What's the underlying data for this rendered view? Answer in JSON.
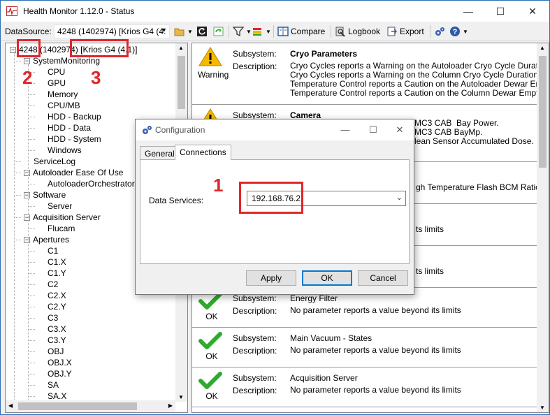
{
  "window": {
    "title": "Health Monitor 1.12.0 - Status",
    "minimize_icon": "—",
    "maximize_icon": "☐",
    "close_icon": "✕"
  },
  "toolbar": {
    "datasource_label": "DataSource:",
    "datasource_value": "4248 (1402974) [Krios G4 (4.",
    "compare_label": "Compare",
    "logbook_label": "Logbook",
    "export_label": "Export"
  },
  "tree": {
    "root_id": "4248",
    "root_serial": "(1402974)",
    "root_name": "[Krios G4 (4.1)]",
    "items": [
      {
        "label": "SystemMonitoring",
        "level": 1,
        "expander": "−"
      },
      {
        "label": "CPU",
        "level": 2
      },
      {
        "label": "GPU",
        "level": 2
      },
      {
        "label": "Memory",
        "level": 2
      },
      {
        "label": "CPU/MB",
        "level": 2
      },
      {
        "label": "HDD - Backup",
        "level": 2
      },
      {
        "label": "HDD - Data",
        "level": 2
      },
      {
        "label": "HDD - System",
        "level": 2
      },
      {
        "label": "Windows",
        "level": 2
      },
      {
        "label": "ServiceLog",
        "level": 1
      },
      {
        "label": "Autoloader Ease Of Use",
        "level": 1,
        "expander": "−"
      },
      {
        "label": "AutoloaderOrchestrator",
        "level": 2
      },
      {
        "label": "Software",
        "level": 1,
        "expander": "−"
      },
      {
        "label": "Server",
        "level": 2
      },
      {
        "label": "Acquisition Server",
        "level": 1,
        "expander": "−"
      },
      {
        "label": "Flucam",
        "level": 2
      },
      {
        "label": "Apertures",
        "level": 1,
        "expander": "−"
      },
      {
        "label": "C1",
        "level": 2
      },
      {
        "label": "C1.X",
        "level": 2
      },
      {
        "label": "C1.Y",
        "level": 2
      },
      {
        "label": "C2",
        "level": 2
      },
      {
        "label": "C2.X",
        "level": 2
      },
      {
        "label": "C2.Y",
        "level": 2
      },
      {
        "label": "C3",
        "level": 2
      },
      {
        "label": "C3.X",
        "level": 2
      },
      {
        "label": "C3.Y",
        "level": 2
      },
      {
        "label": "OBJ",
        "level": 2
      },
      {
        "label": "OBJ.X",
        "level": 2
      },
      {
        "label": "OBJ.Y",
        "level": 2
      },
      {
        "label": "SA",
        "level": 2
      },
      {
        "label": "SA.X",
        "level": 2
      }
    ]
  },
  "status_cards": [
    {
      "status": "Warning",
      "icon": "warning-icon",
      "subsystem_key": "Subsystem:",
      "subsystem": "Cryo Parameters",
      "desc_key": "Description:",
      "description": "Cryo Cycles reports a Warning on the Autoloader Cryo Cycle Duration.\nCryo Cycles reports a Warning on the Column Cryo Cycle Duration.\nTemperature Control reports a Caution on the Autoloader Dewar Empty Lev\nTemperature Control reports a Caution on the Column Dewar Empty Level."
    },
    {
      "status": "",
      "icon": "warning-icon",
      "subsystem_key": "Subsystem:",
      "subsystem": "Camera",
      "desc_key": "Description:",
      "description": "MC3 CAB  Bay Power.\nMC3 CAB BayMp.\nlean Sensor Accumulated Dose."
    },
    {
      "status": "",
      "icon": "",
      "subsystem_key": "",
      "subsystem": "",
      "desc_key": "",
      "description": "gh Temperature Flash BCM Ratio."
    },
    {
      "status": "",
      "icon": "",
      "subsystem_key": "",
      "subsystem": "",
      "desc_key": "",
      "description": "ts limits"
    },
    {
      "status": "",
      "icon": "",
      "subsystem_key": "",
      "subsystem": "",
      "desc_key": "",
      "description": "ts limits"
    },
    {
      "status": "OK",
      "icon": "checkmark-icon",
      "subsystem_key": "Subsystem:",
      "subsystem": "Energy Filter",
      "desc_key": "Description:",
      "description": "No parameter reports a value beyond its limits"
    },
    {
      "status": "OK",
      "icon": "checkmark-icon",
      "subsystem_key": "Subsystem:",
      "subsystem": "Main Vacuum - States",
      "desc_key": "Description:",
      "description": "No parameter reports a value beyond its limits"
    },
    {
      "status": "OK",
      "icon": "checkmark-icon",
      "subsystem_key": "Subsystem:",
      "subsystem": "Acquisition Server",
      "desc_key": "Description:",
      "description": "No parameter reports a value beyond its limits"
    }
  ],
  "dialog": {
    "title": "Configuration",
    "tabs": [
      {
        "label": "General"
      },
      {
        "label": "Connections"
      }
    ],
    "field_label": "Data Services:",
    "field_value": "192.168.76.2",
    "apply_label": "Apply",
    "ok_label": "OK",
    "cancel_label": "Cancel"
  },
  "annotations": {
    "n1": "1",
    "n2": "2",
    "n3": "3",
    "color": "#e0262b"
  },
  "colors": {
    "warning": "#f5b800",
    "ok": "#2eab2e",
    "accent": "#0078d7"
  }
}
